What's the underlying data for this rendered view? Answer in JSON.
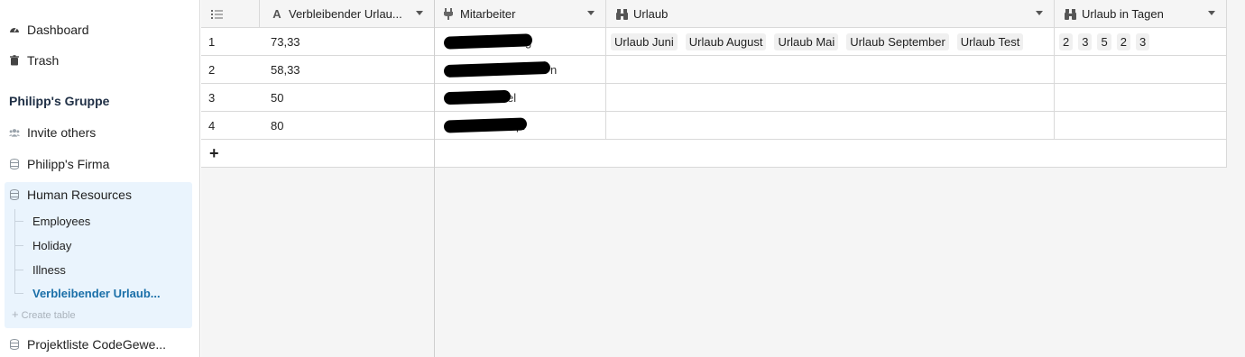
{
  "sidebar": {
    "dashboard": "Dashboard",
    "trash": "Trash",
    "group_title": "Philipp's Gruppe",
    "invite": "Invite others",
    "bases": [
      {
        "label": "Philipp's Firma"
      },
      {
        "label": "Human Resources"
      },
      {
        "label": "Projektliste CodeGewe..."
      }
    ],
    "tables": [
      {
        "label": "Employees"
      },
      {
        "label": "Holiday"
      },
      {
        "label": "Illness"
      },
      {
        "label": "Verbleibender Urlaub..."
      }
    ],
    "create_table": "Create table"
  },
  "grid": {
    "columns": [
      {
        "label": "Verbleibender Urlau...",
        "icon": "text-icon"
      },
      {
        "label": "Mitarbeiter",
        "icon": "link-icon"
      },
      {
        "label": "Urlaub",
        "icon": "lookup-icon"
      },
      {
        "label": "Urlaub in Tagen",
        "icon": "lookup-icon"
      }
    ],
    "rows": [
      {
        "id": "1",
        "remaining": "73,33"
      },
      {
        "id": "2",
        "remaining": "58,33"
      },
      {
        "id": "3",
        "remaining": "50"
      },
      {
        "id": "4",
        "remaining": "80"
      }
    ],
    "urlaub_tags": [
      "Urlaub Juni",
      "Urlaub August",
      "Urlaub Mai",
      "Urlaub September",
      "Urlaub Test"
    ],
    "urlaub_days": [
      "2",
      "3",
      "5",
      "2",
      "3"
    ],
    "employee_fragments": [
      "g",
      "n",
      "el",
      "pl"
    ],
    "add_row": "+"
  },
  "colors": {
    "active_bg": "#eaf4fd",
    "active_text": "#1a6fa8",
    "border": "#d9d9d9"
  }
}
